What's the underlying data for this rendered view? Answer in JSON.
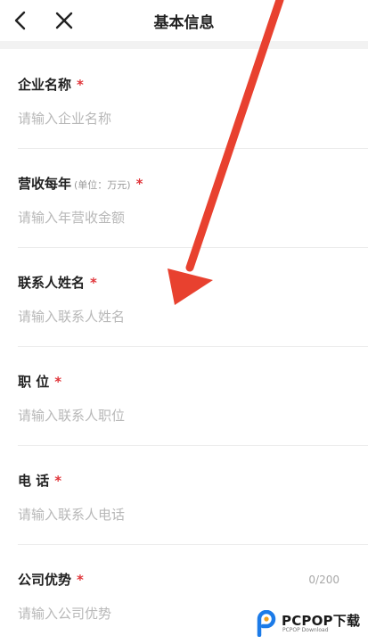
{
  "header": {
    "title": "基本信息",
    "back_icon": "chevron-left-icon",
    "close_icon": "close-icon"
  },
  "required_mark": "*",
  "fields": [
    {
      "label": "企业名称",
      "placeholder": "请输入企业名称"
    },
    {
      "label": "营收每年",
      "unit": "(单位：万元)",
      "placeholder": "请输入年营收金额"
    },
    {
      "label": "联系人姓名",
      "placeholder": "请输入联系人姓名"
    },
    {
      "label": "职 位",
      "placeholder": "请输入联系人职位"
    },
    {
      "label": "电 话",
      "placeholder": "请输入联系人电话"
    },
    {
      "label": "公司优势",
      "placeholder": "请输入公司优势",
      "counter": "0/200"
    }
  ],
  "watermark": {
    "text": "PCPOP下载",
    "sub": "PCPOP Download"
  },
  "colors": {
    "required": "#e0353a",
    "arrow": "#e8412f",
    "placeholder": "#b8b8b8",
    "logo": "#1c7be8"
  }
}
